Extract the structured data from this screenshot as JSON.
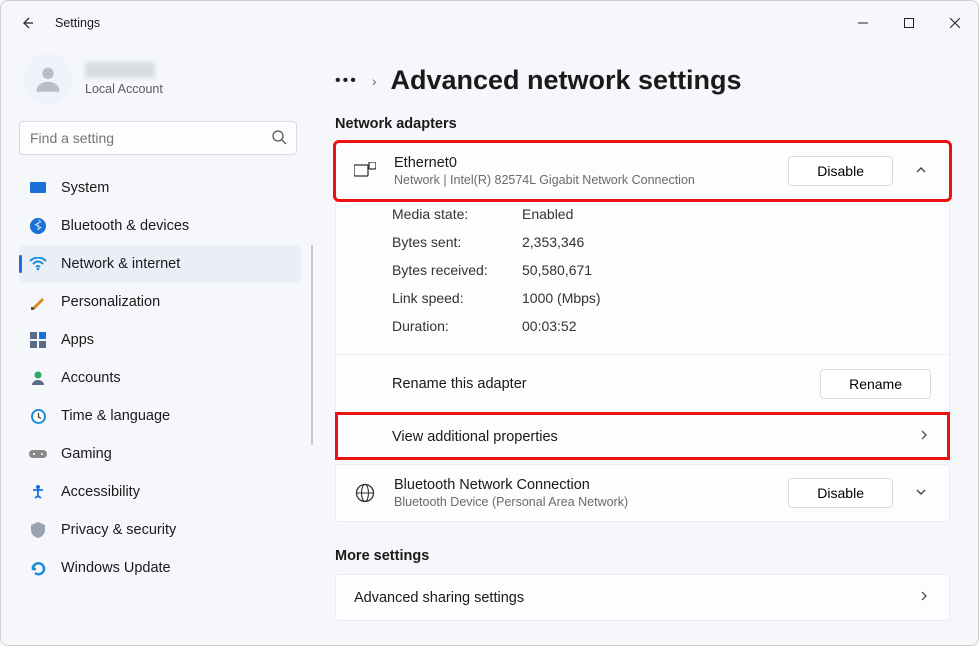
{
  "window": {
    "title": "Settings"
  },
  "account": {
    "type": "Local Account"
  },
  "search": {
    "placeholder": "Find a setting"
  },
  "sidebar": {
    "items": [
      {
        "label": "System"
      },
      {
        "label": "Bluetooth & devices"
      },
      {
        "label": "Network & internet"
      },
      {
        "label": "Personalization"
      },
      {
        "label": "Apps"
      },
      {
        "label": "Accounts"
      },
      {
        "label": "Time & language"
      },
      {
        "label": "Gaming"
      },
      {
        "label": "Accessibility"
      },
      {
        "label": "Privacy & security"
      },
      {
        "label": "Windows Update"
      }
    ]
  },
  "page": {
    "title": "Advanced network settings",
    "section_adapters": "Network adapters",
    "section_more": "More settings"
  },
  "adapters": [
    {
      "name": "Ethernet0",
      "sub": "Network | Intel(R) 82574L Gigabit Network Connection",
      "action": "Disable",
      "expanded": true,
      "details": {
        "rows": [
          {
            "label": "Media state:",
            "value": "Enabled"
          },
          {
            "label": "Bytes sent:",
            "value": "2,353,346"
          },
          {
            "label": "Bytes received:",
            "value": "50,580,671"
          },
          {
            "label": "Link speed:",
            "value": "1000 (Mbps)"
          },
          {
            "label": "Duration:",
            "value": "00:03:52"
          }
        ],
        "rename_label": "Rename this adapter",
        "rename_button": "Rename",
        "view_props": "View additional properties"
      }
    },
    {
      "name": "Bluetooth Network Connection",
      "sub": "Bluetooth Device (Personal Area Network)",
      "action": "Disable",
      "expanded": false
    }
  ],
  "more": {
    "items": [
      {
        "label": "Advanced sharing settings"
      }
    ]
  }
}
